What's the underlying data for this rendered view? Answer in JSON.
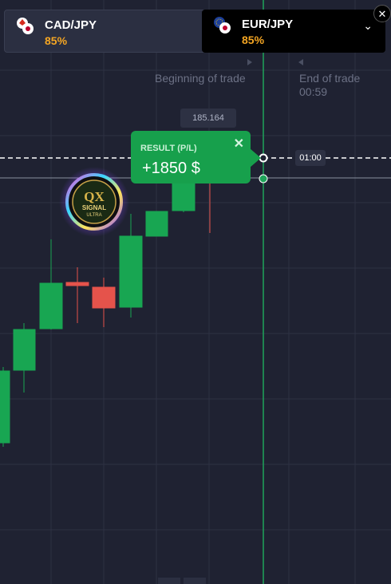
{
  "tabs": [
    {
      "pair": "CAD/JPY",
      "payout": "85%"
    },
    {
      "pair": "EUR/JPY",
      "payout": "85%"
    }
  ],
  "close_icon": "✕",
  "dropdown_icon": "chevron-down-icon",
  "trade_labels": {
    "beginning": "Beginning of trade",
    "end": "End of trade",
    "countdown": "00:59"
  },
  "price_badge": "185.164",
  "time_badge": "01:00",
  "result": {
    "title": "RESULT (P/L)",
    "amount": "+1850 $"
  },
  "logo_text": {
    "top": "QX",
    "bottom": "SIGNAL",
    "sub": "ULTRA"
  },
  "colors": {
    "background": "#1f2232",
    "bull": "#18a652",
    "bear": "#e5534b",
    "payout": "#f5a623",
    "accent_line": "#1fa35a"
  }
}
